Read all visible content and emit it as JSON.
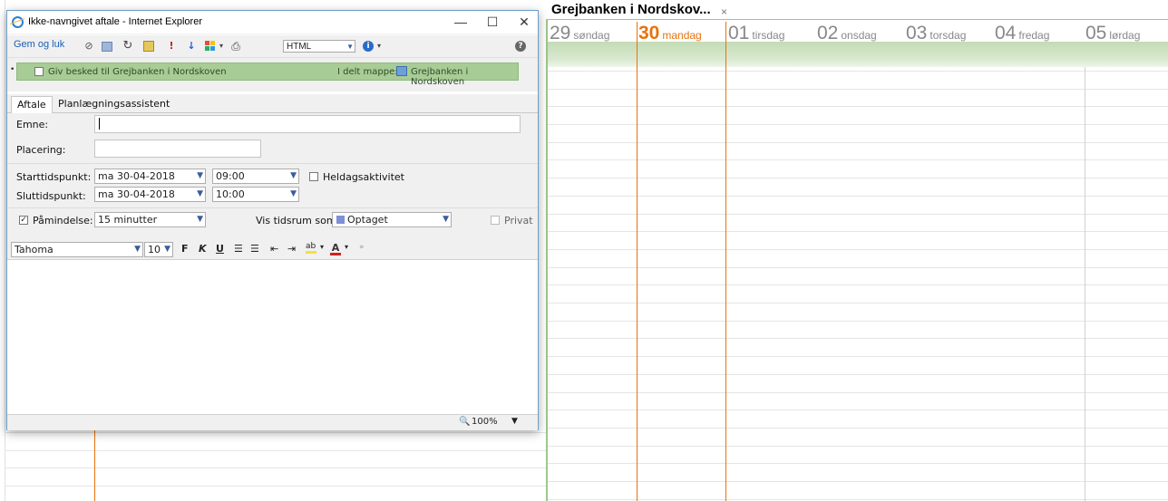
{
  "calendar": {
    "title": "Grejbanken i Nordskov...",
    "close_glyph": "×",
    "days": [
      {
        "num": "29",
        "name": "søndag"
      },
      {
        "num": "30",
        "name": "mandag"
      },
      {
        "num": "01",
        "name": "tirsdag"
      },
      {
        "num": "02",
        "name": "onsdag"
      },
      {
        "num": "03",
        "name": "torsdag"
      },
      {
        "num": "04",
        "name": "fredag"
      },
      {
        "num": "05",
        "name": "lørdag"
      }
    ],
    "today_index": 1,
    "accent": "#e8730c",
    "band_color": "#c3dbb5"
  },
  "window": {
    "title": "Ikke-navngivet aftale - Internet Explorer",
    "minimize": "—",
    "maximize": "☐",
    "close": "✕"
  },
  "toolbar": {
    "save_close": "Gem og luk",
    "format": "HTML",
    "help": "?"
  },
  "infobar": {
    "notify_label": "Giv besked til Grejbanken i Nordskoven",
    "shared_label": "I delt mappe:",
    "shared_folder": "Grejbanken i Nordskoven"
  },
  "tabs": [
    "Aftale",
    "Planlægningsassistent"
  ],
  "form": {
    "subject_label": "Emne:",
    "subject_value": "",
    "location_label": "Placering:",
    "location_value": "",
    "start_label": "Starttidspunkt:",
    "start_date": "ma 30-04-2018",
    "start_time": "09:00",
    "allday_label": "Heldagsaktivitet",
    "end_label": "Sluttidspunkt:",
    "end_date": "ma 30-04-2018",
    "end_time": "10:00",
    "reminder_label": "Påmindelse:",
    "reminder_value": "15 minutter",
    "showas_label": "Vis tidsrum som:",
    "showas_value": "Optaget",
    "private_label": "Privat"
  },
  "formatting": {
    "font": "Tahoma",
    "size": "10",
    "bold": "F",
    "italic": "K",
    "underline": "U"
  },
  "status": {
    "zoom": "100%"
  }
}
